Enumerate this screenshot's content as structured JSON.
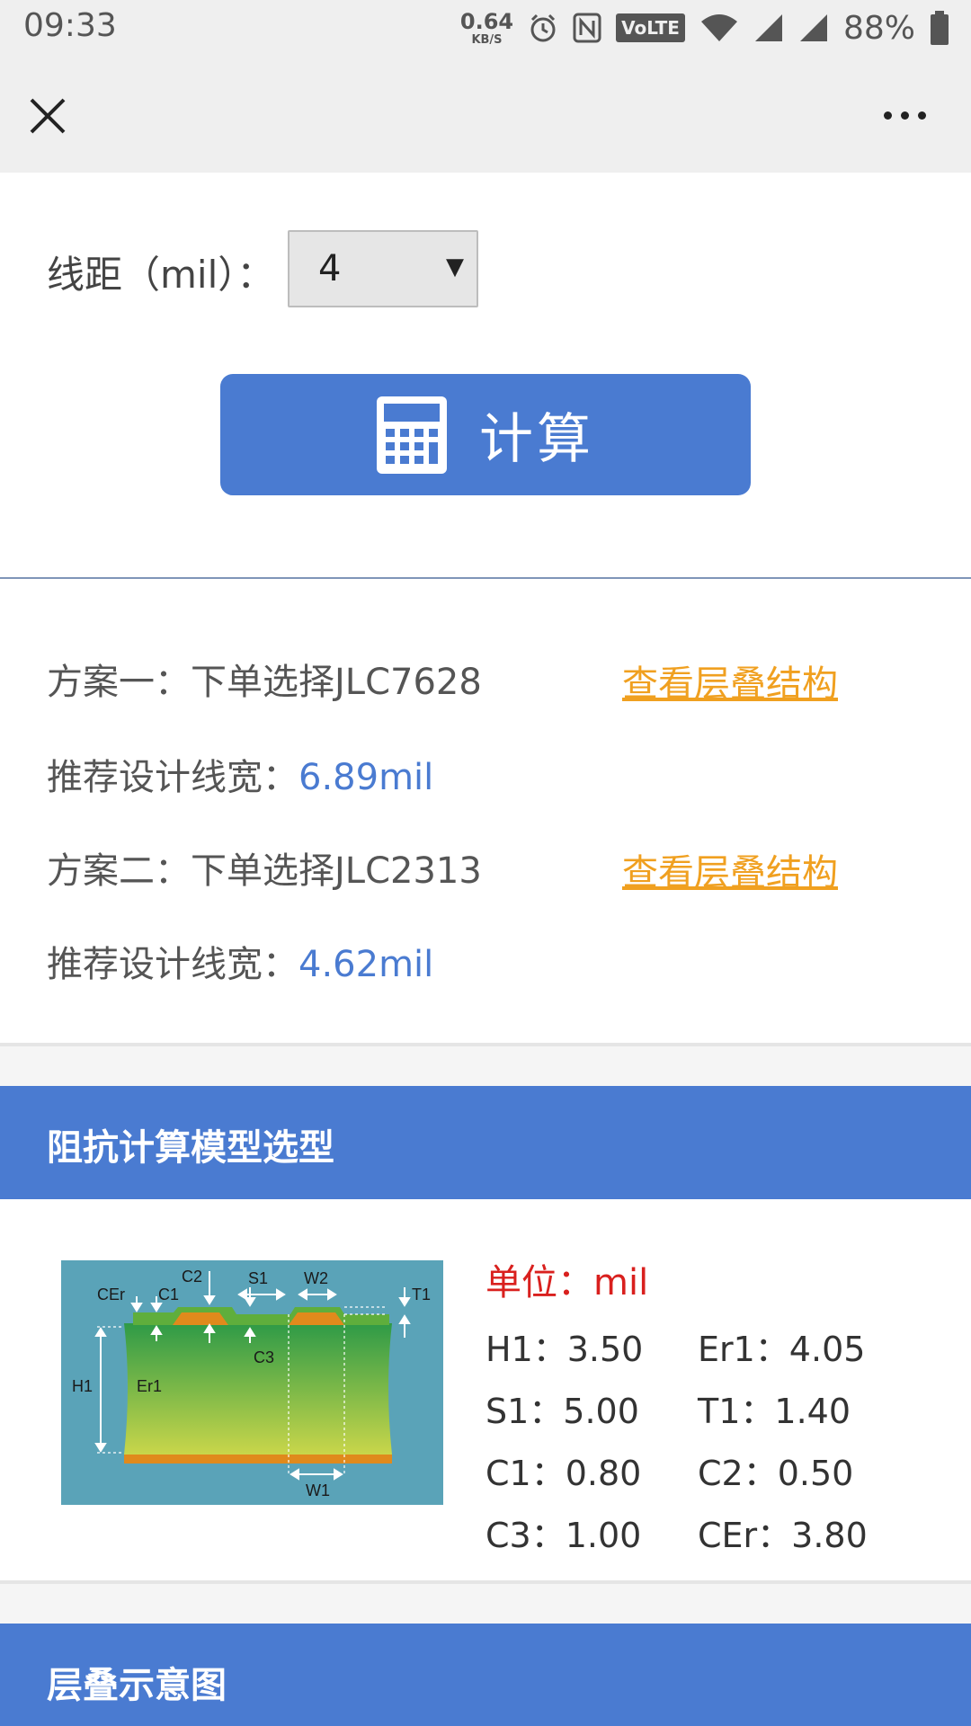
{
  "status": {
    "time": "09:33",
    "speed_value": "0.64",
    "speed_unit": "KB/S",
    "volte": "VoLTE",
    "battery": "88%"
  },
  "titlebar": {
    "close_icon": "close-icon",
    "more_icon": "more-dots-icon"
  },
  "form": {
    "spacing_label": "线距（mil）：",
    "spacing_value": "4",
    "calc_label": "计算",
    "calc_icon": "calculator-icon"
  },
  "results": {
    "plan1": "方案一：下单选择JLC7628",
    "plan1_link": "查看层叠结构",
    "plan1_width_label": "推荐设计线宽：",
    "plan1_width_value": "6.89mil",
    "plan2": "方案二：下单选择JLC2313",
    "plan2_link": "查看层叠结构",
    "plan2_width_label": "推荐设计线宽：",
    "plan2_width_value": "4.62mil"
  },
  "model": {
    "header": "阻抗计算模型选型",
    "unit": "单位：mil",
    "params": [
      [
        "H1：3.50",
        "Er1：4.05"
      ],
      [
        "S1：5.00",
        "T1：1.40"
      ],
      [
        "C1：0.80",
        "C2：0.50"
      ],
      [
        "C3：1.00",
        "CEr：3.80"
      ]
    ],
    "diagram_labels": {
      "c2": "C2",
      "s1": "S1",
      "w2": "W2",
      "cer": "CEr",
      "c1": "C1",
      "t1": "T1",
      "c3": "C3",
      "h1": "H1",
      "er1": "Er1",
      "w1": "W1"
    }
  },
  "stack": {
    "header": "层叠示意图"
  },
  "colors": {
    "accent": "#4a7bd1",
    "link": "#f0a020",
    "unit_red": "#d9201e"
  }
}
